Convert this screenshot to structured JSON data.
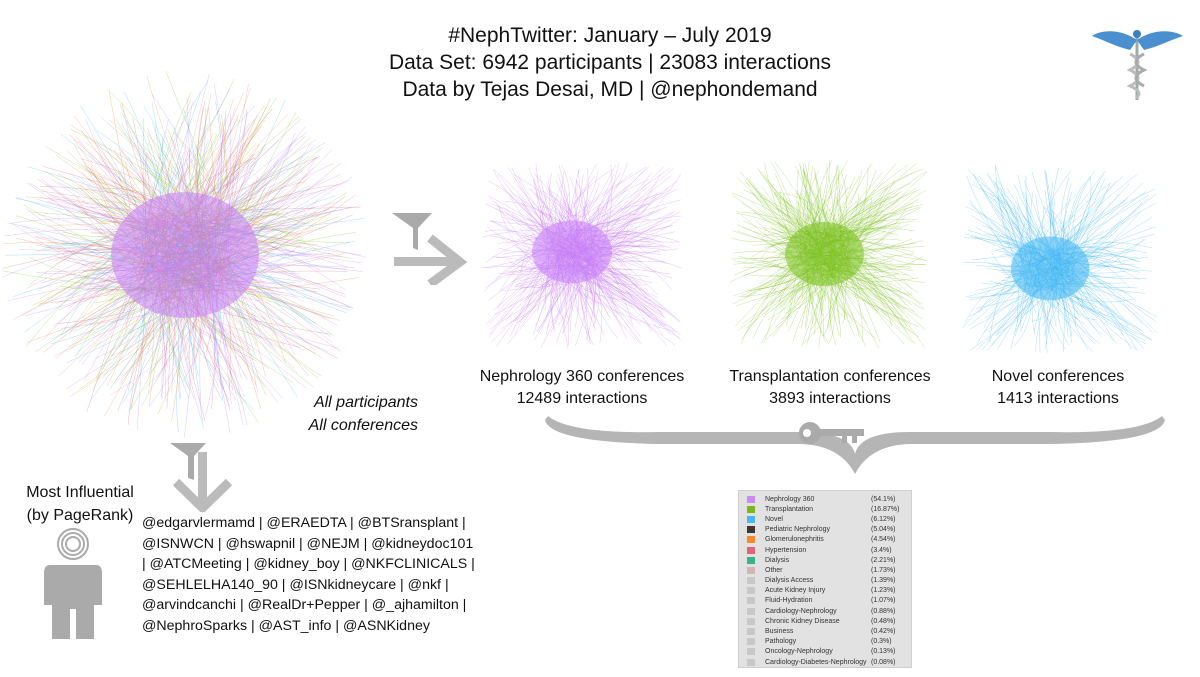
{
  "header": {
    "line1": "#NephTwitter:  January – July 2019",
    "line2": "Data Set: 6942 participants | 23083 interactions",
    "line3": "Data by Tejas Desai, MD | @nephondemand"
  },
  "logo": {
    "icon": "caduceus-icon"
  },
  "all_network": {
    "line1": "All participants",
    "line2": "All conferences"
  },
  "subnetworks": [
    {
      "title": "Nephrology 360 conferences",
      "count": "12489 interactions",
      "color": "#c77df5"
    },
    {
      "title": "Transplantation conferences",
      "count": "3893 interactions",
      "color": "#7cc11f"
    },
    {
      "title": "Novel conferences",
      "count": "1413 interactions",
      "color": "#3fb6f2"
    }
  ],
  "icons": {
    "filter_right": "filter-arrow-right-icon",
    "filter_down": "filter-arrow-down-icon",
    "key": "key-icon",
    "person": "person-icon",
    "brace": "brace-icon"
  },
  "influential": {
    "line1": "Most Influential",
    "line2": "(by PageRank)",
    "lines": [
      "@edgarvlermamd | @ERAEDTA | @BTSransplant |",
      "@ISNWCN | @hswapnil | @NEJM | @kidneydoc101",
      "| @ATCMeeting | @kidney_boy | @NKFCLINICALS |",
      "@SEHLELHA140_90 | @ISNkidneycare | @nkf |",
      "@arvindcanchi | @RealDr+Pepper | @_ajhamilton |",
      "@NephroSparks | @AST_info | @ASNKidney"
    ]
  },
  "legend": [
    {
      "name": "Nephrology 360",
      "pct": "(54.1%)",
      "color": "#c98cf7"
    },
    {
      "name": "Transplantation",
      "pct": "(16.87%)",
      "color": "#7db51c"
    },
    {
      "name": "Novel",
      "pct": "(6.12%)",
      "color": "#48b8f5"
    },
    {
      "name": "Pediatric Nephrology",
      "pct": "(5.04%)",
      "color": "#3e3630"
    },
    {
      "name": "Glomerulonephritis",
      "pct": "(4.54%)",
      "color": "#f08a2c"
    },
    {
      "name": "Hypertension",
      "pct": "(3.4%)",
      "color": "#e2627a"
    },
    {
      "name": "Dialysis",
      "pct": "(2.21%)",
      "color": "#3fae8c"
    },
    {
      "name": "Other",
      "pct": "(1.73%)",
      "color": "#d2b6b6"
    },
    {
      "name": "Dialysis Access",
      "pct": "(1.39%)",
      "color": "#c8c8c8"
    },
    {
      "name": "Acute Kidney Injury",
      "pct": "(1.23%)",
      "color": "#c8c8c8"
    },
    {
      "name": "Fluid-Hydration",
      "pct": "(1.07%)",
      "color": "#c8c8c8"
    },
    {
      "name": "Cardiology-Nephrology",
      "pct": "(0.88%)",
      "color": "#c8c8c8"
    },
    {
      "name": "Chronic Kidney Disease",
      "pct": "(0.48%)",
      "color": "#c8c8c8"
    },
    {
      "name": "Business",
      "pct": "(0.42%)",
      "color": "#c8c8c8"
    },
    {
      "name": "Pathology",
      "pct": "(0.3%)",
      "color": "#c8c8c8"
    },
    {
      "name": "Oncology-Nephrology",
      "pct": "(0.13%)",
      "color": "#c8c8c8"
    },
    {
      "name": "Cardiology-Diabetes-Nephrology",
      "pct": "(0.08%)",
      "color": "#c8c8c8"
    }
  ]
}
